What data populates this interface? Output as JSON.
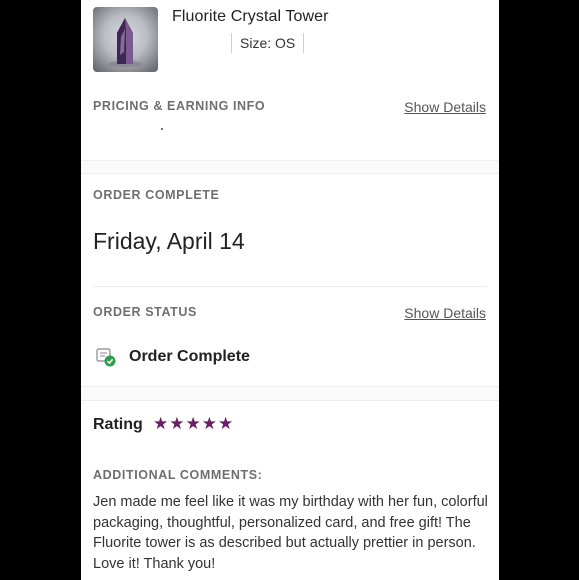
{
  "product": {
    "title": "Fluorite Crystal Tower",
    "size_label": "Size: OS",
    "thumbnail_icon": "crystal-tower-photo"
  },
  "pricing": {
    "label": "PRICING & EARNING INFO",
    "show_details": "Show Details"
  },
  "order_complete": {
    "label": "ORDER COMPLETE",
    "date": "Friday, April 14"
  },
  "order_status": {
    "label": "ORDER STATUS",
    "show_details": "Show Details",
    "status": "Order Complete",
    "status_icon": "order-complete-check-icon",
    "status_color": "#2e9e4d"
  },
  "rating": {
    "label": "Rating",
    "stars": 5,
    "star_color": "#6b1e63"
  },
  "comments": {
    "label": "ADDITIONAL COMMENTS:",
    "text": "Jen made me feel like it was my birthday with her fun, colorful packaging, thoughtful, personalized card, and free gift! The Fluorite tower is as described but actually prettier in person. Love it! Thank you!"
  }
}
